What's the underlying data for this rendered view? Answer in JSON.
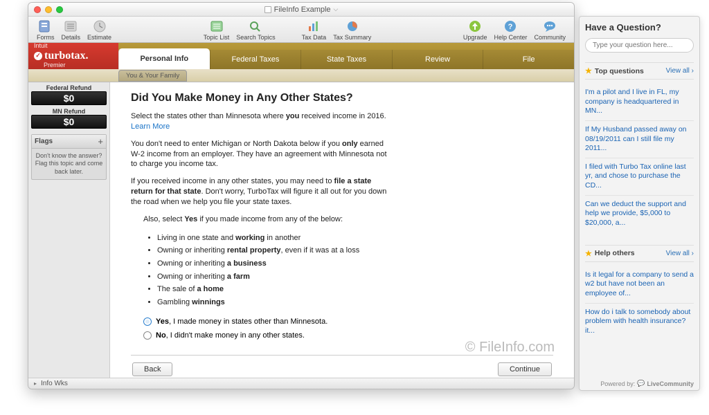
{
  "window": {
    "title": "FileInfo Example"
  },
  "toolbar": {
    "left": [
      {
        "name": "forms",
        "label": "Forms"
      },
      {
        "name": "details",
        "label": "Details"
      },
      {
        "name": "estimate",
        "label": "Estimate"
      }
    ],
    "center": [
      {
        "name": "topiclist",
        "label": "Topic List"
      },
      {
        "name": "searchtopics",
        "label": "Search Topics"
      }
    ],
    "right1": [
      {
        "name": "taxdata",
        "label": "Tax Data"
      },
      {
        "name": "taxsummary",
        "label": "Tax Summary"
      }
    ],
    "far": [
      {
        "name": "upgrade",
        "label": "Upgrade"
      },
      {
        "name": "helpcenter",
        "label": "Help Center"
      },
      {
        "name": "community",
        "label": "Community"
      }
    ]
  },
  "brand": {
    "intuit": "Intuit",
    "name": "turbotax.",
    "edition": "Premier"
  },
  "maintabs": [
    "Personal Info",
    "Federal Taxes",
    "State Taxes",
    "Review",
    "File"
  ],
  "activeMainTab": 0,
  "subtab": "You & Your Family",
  "refunds": [
    {
      "label": "Federal Refund",
      "amount": "$0"
    },
    {
      "label": "MN Refund",
      "amount": "$0"
    }
  ],
  "flags": {
    "title": "Flags",
    "hint": "Don't know the answer? Flag this topic and come back later."
  },
  "page": {
    "heading": "Did You Make Money in Any Other States?",
    "p1_a": "Select the states other than Minnesota where ",
    "p1_b": "you",
    "p1_c": " received income in 2016. ",
    "learn": "Learn More",
    "p2_a": "You don't need to enter Michigan or North Dakota below if you ",
    "p2_b": "only",
    "p2_c": " earned W-2 income from an employer. They have an agreement with Minnesota not to charge you income tax.",
    "p3_a": "If you received income in any other states, you may need to ",
    "p3_b": "file a state return for that state",
    "p3_c": ". Don't worry, TurboTax will figure it all out for you down the road when we help you file your state taxes.",
    "p4_a": "Also, select ",
    "p4_b": "Yes",
    "p4_c": " if you made income from any of the below:",
    "bullets": [
      {
        "a": "Living in one state and ",
        "b": "working",
        "c": " in another"
      },
      {
        "a": "Owning or inheriting ",
        "b": "rental property",
        "c": ", even if it was at a loss"
      },
      {
        "a": "Owning or inheriting ",
        "b": "a business",
        "c": ""
      },
      {
        "a": "Owning or inheriting ",
        "b": "a farm",
        "c": ""
      },
      {
        "a": "The sale of ",
        "b": "a home",
        "c": ""
      },
      {
        "a": "Gambling ",
        "b": "winnings",
        "c": ""
      }
    ],
    "radios": [
      {
        "b": "Yes",
        "rest": ", I made money in states other than Minnesota.",
        "selected": true
      },
      {
        "b": "No",
        "rest": ", I didn't make money in any other states.",
        "selected": false
      }
    ],
    "back": "Back",
    "continue": "Continue"
  },
  "watermark": "© FileInfo.com",
  "status": {
    "text": "Info Wks"
  },
  "help": {
    "title": "Have a Question?",
    "placeholder": "Type your question here...",
    "top_label": "Top questions",
    "viewall": "View all",
    "top_questions": [
      "I'm a pilot and I live in FL, my company is headquartered in MN...",
      "If My Husband passed away on 08/19/2011 can I still file my 2011...",
      "I filed with Turbo Tax online last yr, and chose to purchase the CD...",
      "Can we deduct the support and help we provide, $5,000 to $20,000, a..."
    ],
    "help_others_label": "Help others",
    "help_others": [
      "Is it legal for a company to send a w2 but have not been an employee of...",
      "How do i talk to somebody about problem with health insurance? it..."
    ],
    "powered": "Powered by:",
    "powered_name": "LiveCommunity"
  }
}
